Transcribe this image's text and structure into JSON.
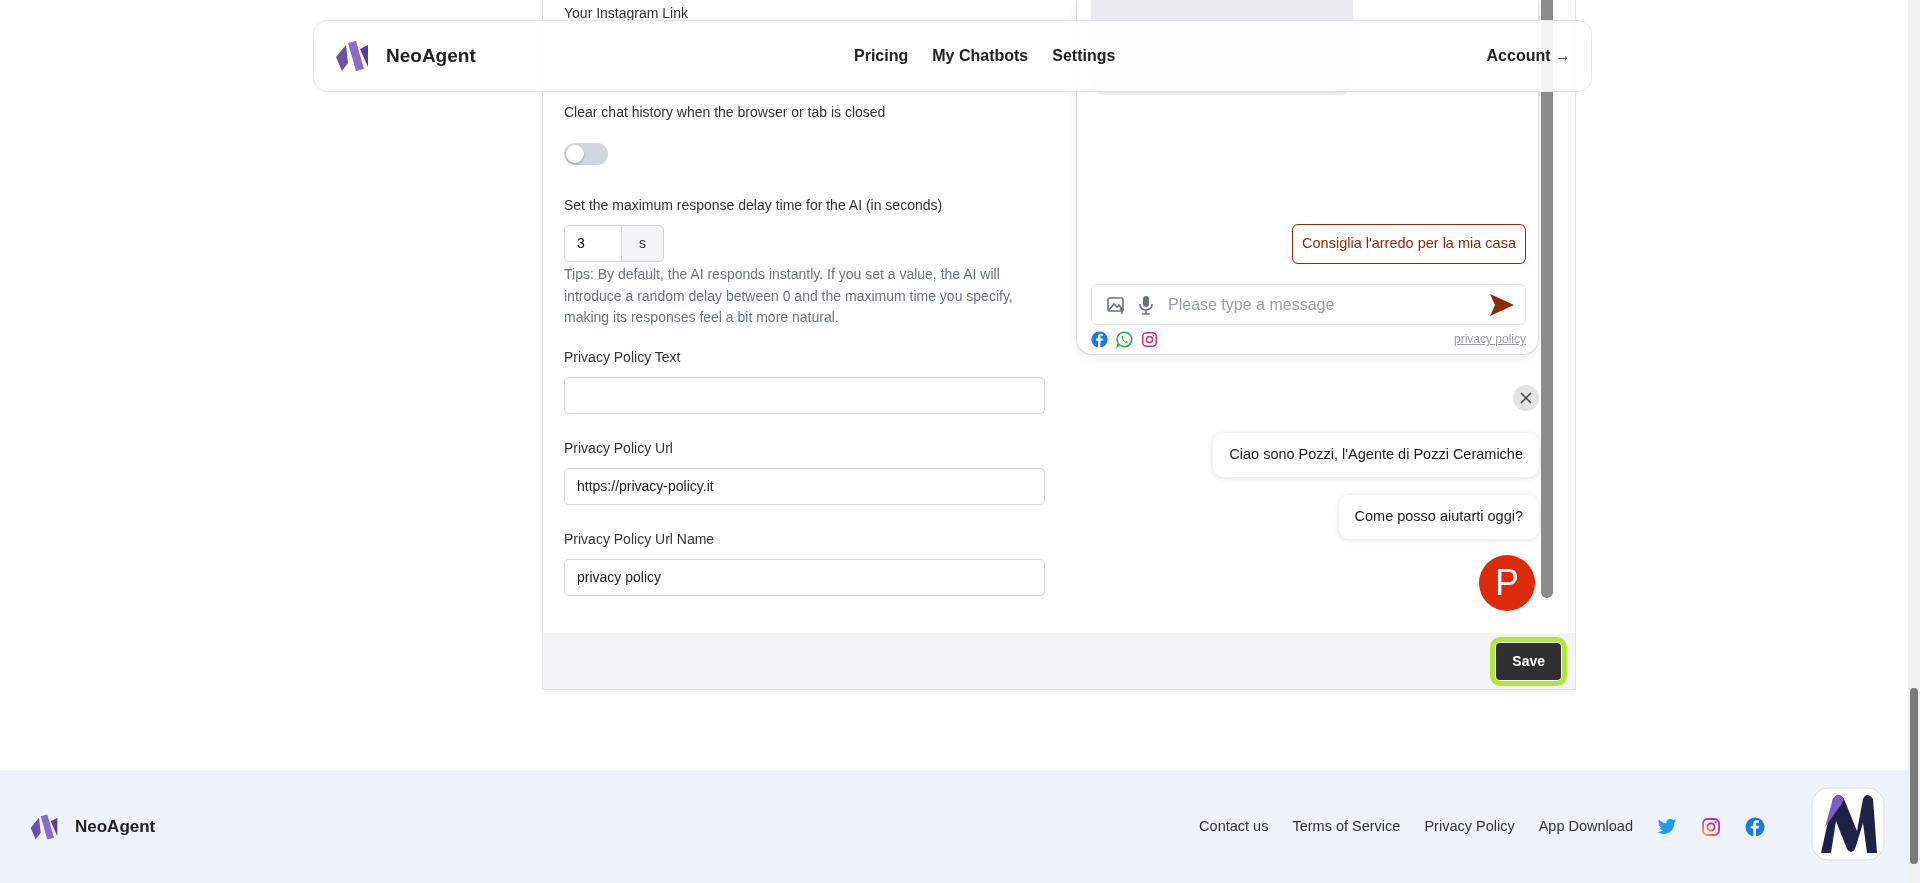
{
  "navbar": {
    "brand": "NeoAgent",
    "links": [
      {
        "label": "Pricing"
      },
      {
        "label": "My Chatbots"
      },
      {
        "label": "Settings"
      }
    ],
    "account": "Account",
    "account_arrow": "→"
  },
  "form": {
    "instagram": {
      "label": "Your Instagram Link"
    },
    "clear_history": {
      "label": "Clear chat history when the browser or tab is closed",
      "on": false
    },
    "delay": {
      "label": "Set the maximum response delay time for the AI (in seconds)",
      "value": "3",
      "unit": "s",
      "tip": "Tips: By default, the AI responds instantly. If you set a value, the AI will introduce a random delay between 0 and the maximum time you specify, making its responses feel a bit more natural."
    },
    "fields": [
      {
        "label": "Privacy Policy Text"
      },
      {
        "label": "Privacy Policy Url",
        "value": "https://privacy-policy.it"
      },
      {
        "label": "Privacy Policy Url Name",
        "value": "privacy policy"
      }
    ]
  },
  "preview": {
    "suggestion": "Consiglia l'arredo per la mia casa",
    "message_placeholder": "Please type a message",
    "privacy_link": "privacy policy",
    "greetings": [
      "Ciao sono Pozzi, l'Agente di Pozzi Ceramiche",
      "Come posso aiutarti oggi?"
    ],
    "avatar_letter": "P"
  },
  "save": {
    "label": "Save",
    "highlighted": true
  },
  "footer": {
    "brand": "NeoAgent",
    "links": [
      "Contact us",
      "Terms of Service",
      "Privacy Policy",
      "App Download"
    ]
  }
}
